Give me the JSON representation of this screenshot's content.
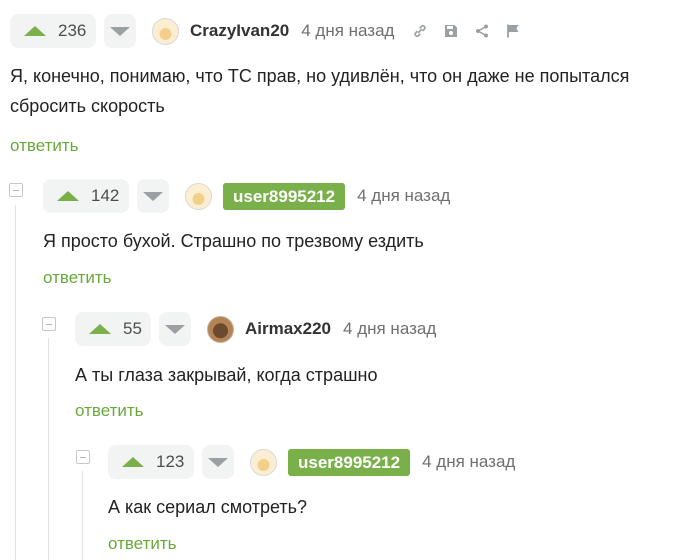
{
  "comments": [
    {
      "votes": "236",
      "username": "CrazyIvan20",
      "time": "4 дня назад",
      "text": "Я, конечно, понимаю, что ТС прав, но удивлён, что он даже не попытался сбросить скорость",
      "reply_label": "ответить",
      "avatar": "cat-avatar",
      "action_icons": [
        "link-icon",
        "save-icon",
        "share-icon",
        "flag-icon"
      ]
    },
    {
      "votes": "142",
      "username": "user8995212",
      "time": "4 дня назад",
      "text": "Я просто бухой. Страшно по трезвому ездить",
      "reply_label": "ответить",
      "avatar": "cat-avatar"
    },
    {
      "votes": "55",
      "username": "Airmax220",
      "time": "4 дня назад",
      "text": "А ты глаза закрывай, когда страшно",
      "reply_label": "ответить",
      "avatar": "dog-avatar"
    },
    {
      "votes": "123",
      "username": "user8995212",
      "time": "4 дня назад",
      "text": "А как сериал смотреть?",
      "reply_label": "ответить",
      "avatar": "cat-avatar"
    }
  ],
  "colors": {
    "accent_green": "#79b04a",
    "reply_green": "#69a93c",
    "vote_bg": "#f2f4f3",
    "muted_text": "#6f6f6f"
  }
}
